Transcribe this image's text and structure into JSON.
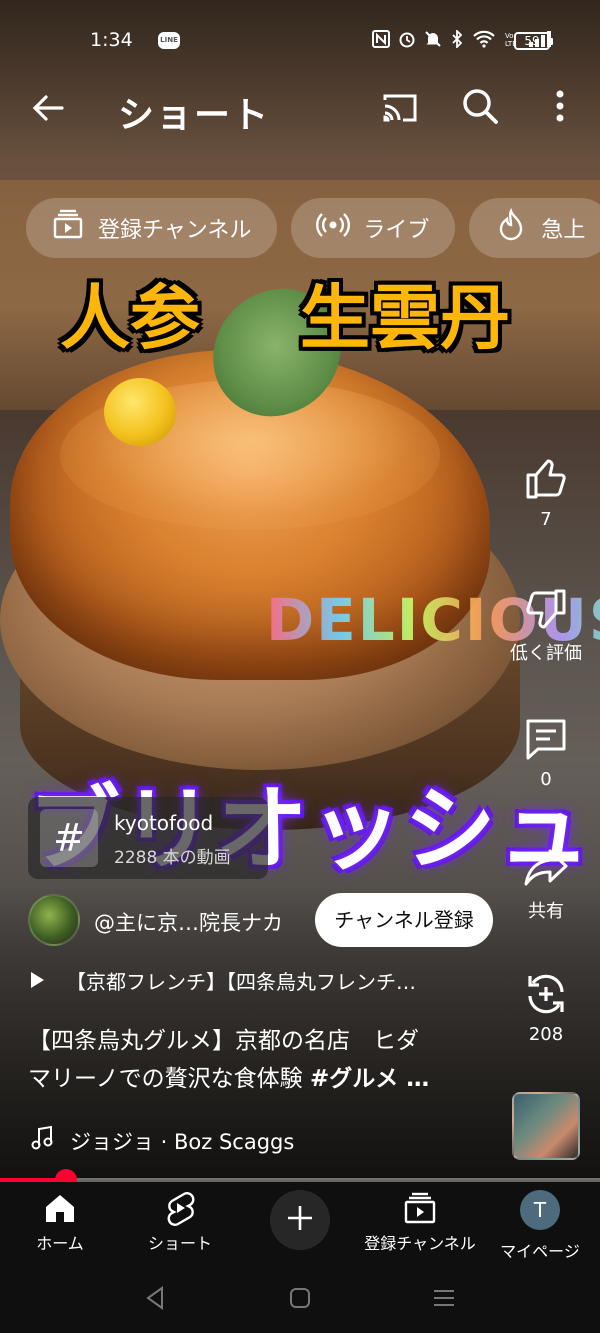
{
  "status_bar": {
    "time": "1:34",
    "line_badge": "LINE",
    "battery": "59",
    "icons": [
      "nfc-icon",
      "alarm-icon",
      "mute-icon",
      "bluetooth-icon",
      "wifi-icon",
      "volte-icon",
      "signal-icon"
    ]
  },
  "header": {
    "title": "ショート"
  },
  "chips": [
    {
      "label": "登録チャンネル",
      "icon": "subscriptions-icon"
    },
    {
      "label": "ライブ",
      "icon": "live-icon"
    },
    {
      "label": "急上",
      "icon": "trending-icon"
    }
  ],
  "video": {
    "caption_left": "人参",
    "caption_right": "生雲丹",
    "caption_delicious": "DELICIOUS",
    "caption_main": "ブリオッシュ"
  },
  "actions": {
    "like_count": "7",
    "dislike_label": "低く評価",
    "comment_count": "0",
    "share_label": "共有",
    "remix_count": "208"
  },
  "hashtag": {
    "name": "kyotofood",
    "count": "2288 本の動画"
  },
  "channel": {
    "name": "@主に京…院長ナカ",
    "subscribe_label": "チャンネル登録"
  },
  "playlist": {
    "text": "【京都フレンチ】【四条烏丸フレンチ…"
  },
  "description": {
    "line1": "【四条烏丸グルメ】京都の名店　ヒダ",
    "line2": "マリーノでの贅沢な食体験 ",
    "hashtag": "#グルメ …"
  },
  "music": {
    "text": "ジョジョ · Boz Scaggs"
  },
  "progress": {
    "fraction": 0.11
  },
  "bottom_nav": {
    "home": "ホーム",
    "shorts": "ショート",
    "subscriptions": "登録チャンネル",
    "you": "マイページ",
    "avatar_letter": "T"
  },
  "colors": {
    "accent_red": "#ff0033",
    "nav_bg": "#0f0f0f",
    "caption_orange": "#ffb60a",
    "caption_glow": "#7a2cff"
  }
}
